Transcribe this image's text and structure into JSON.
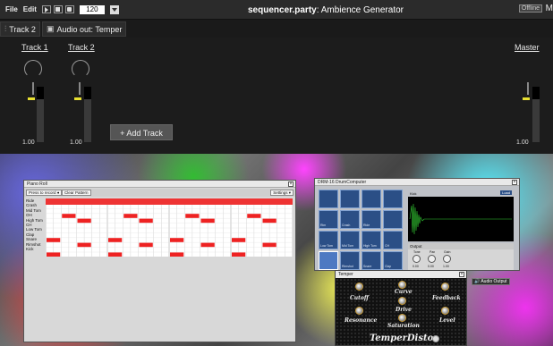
{
  "menubar": {
    "file": "File",
    "edit": "Edit",
    "bpm": "120",
    "title_bold": "sequencer.party",
    "title_rest": ": Ambience Generator",
    "offline": "Offline",
    "m_cut": "M"
  },
  "trackbar": {
    "track_tab": "Track 2",
    "audio_out": "Audio out: Temper"
  },
  "mixer": {
    "channels": [
      {
        "label": "Track 1",
        "value": "1.00"
      },
      {
        "label": "Track 2",
        "value": "1.00"
      }
    ],
    "master": {
      "label": "Master",
      "value": "1.00"
    },
    "add_track": "+ Add Track"
  },
  "piano_roll": {
    "title": "Piano Roll",
    "press_to_record": "Press to record",
    "clear_pattern": "Clear Pattern",
    "settings": "Settings",
    "keys": [
      "Ride",
      "Crash",
      "Mid Tom",
      "OH",
      "High Tom",
      "CH",
      "Low Tom",
      "Clap",
      "Snare",
      "Rimshot",
      "Kick"
    ]
  },
  "drum_computer": {
    "title": "DRM-16 DrumComputer",
    "pads_row1": [
      "",
      "",
      "",
      ""
    ],
    "pads_row2": [
      "Rim",
      "Crash",
      "Ride",
      ""
    ],
    "pads_row3": [
      "Low Tom",
      "Mid Tom",
      "High Tom",
      "CH"
    ],
    "pads_row4": [
      "",
      "Rimshot",
      "Snare",
      "Clap"
    ],
    "wave_label": "Kick",
    "load": "Load",
    "output": "Output",
    "tone": "Tone",
    "pan": "Pan",
    "gain": "Gain",
    "tone_val": "0.00",
    "pan_val": "0.00",
    "gain_val": "1.00"
  },
  "temper": {
    "title": "Temper",
    "cutoff": "Cutoff",
    "curve": "Curve",
    "feedback": "Feedback",
    "drive": "Drive",
    "resonance": "Resonance",
    "saturation": "Saturation",
    "level": "Level",
    "brand": "TemperDisto"
  },
  "audio_output": "Audio Output"
}
